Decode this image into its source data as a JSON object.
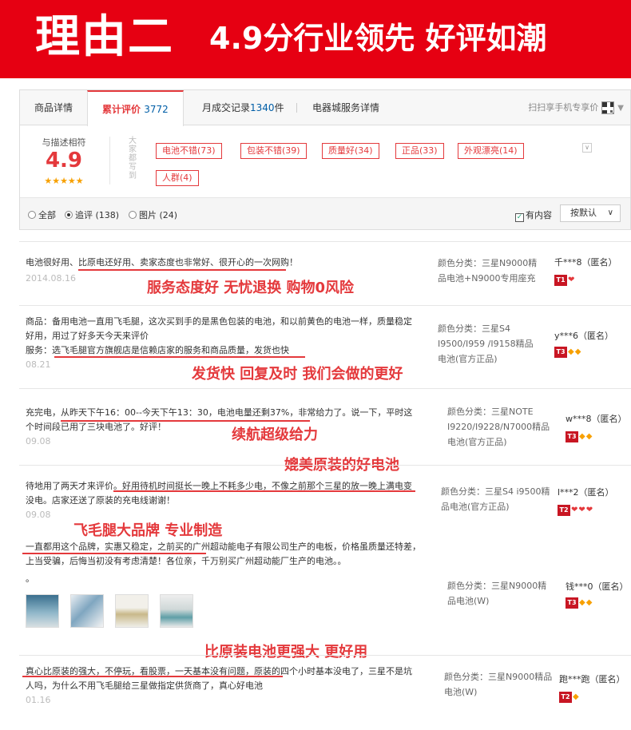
{
  "banner": {
    "reason": "理由二",
    "slogan": "4.9分行业领先 好评如潮"
  },
  "tabs": [
    {
      "label": "商品详情"
    },
    {
      "label": "累计评价",
      "count": "3772"
    },
    {
      "label": "月成交记录",
      "count": "1340",
      "suffix": "件"
    },
    {
      "label": "电器城服务详情"
    }
  ],
  "qr_text": "扫扫享手机专享价",
  "score": {
    "label": "与描述相符",
    "value": "4.9",
    "stars": "★★★★★"
  },
  "tags_caption": "大家都写到",
  "tags": [
    "电池不错(73)",
    "包装不错(39)",
    "质量好(34)",
    "正品(33)",
    "外观漂亮(14)",
    "人群(4)"
  ],
  "filters": {
    "all": "全部",
    "append": "追评 (138)",
    "pics": "图片 (24)",
    "has_content": "有内容",
    "sort": "按默认"
  },
  "reviews": [
    {
      "text": "电池很好用、比原电还好用、卖家态度也非常好、很开心的一次网购！",
      "date": "2014.08.16",
      "sku": "颜色分类：三星N9000精品电池+N9000专用座充",
      "user": "千***8（匿名）",
      "level": "T1"
    },
    {
      "text": "商品：备用电池一直用飞毛腿，这次买到手的是黑色包装的电池，和以前黄色的电池一样，质量稳定好用，用过了好多天今天来评价",
      "text2": "服务：选飞毛腿官方旗舰店是信赖店家的服务和商品质量，发货也快",
      "date": "08.21",
      "sku": "颜色分类：三星S4 I9500/I959 /I9158精品电池(官方正品)",
      "user": "y***6（匿名）",
      "level": "T3"
    },
    {
      "text": "充完电，从昨天下午16：00--今天下午13：30，电池电量还剩37%，非常给力了。说一下，平时这个时间段已用了三块电池了。好评！",
      "date": "09.08",
      "sku": "颜色分类：三星NOTE I9220/I9228/N7000精品电池(官方正品)",
      "user": "w***8（匿名）",
      "level": "T3"
    },
    {
      "text": "待地用了两天才来评价。好用待机时间挺长一晚上不耗多少电，不像之前那个三星的放一晚上满电变没电。店家还送了原装的充电线谢谢！",
      "date": "09.08",
      "sku": "颜色分类：三星S4 i9500精品电池(官方正品)",
      "user": "l***2（匿名）",
      "level": "T2"
    },
    {
      "text": "一直都用这个品牌，实惠又稳定，之前买的广州超动能电子有限公司生产的电板，价格虽质量还特差，上当受骗，后悔当初没有考虑清楚！各位亲，千万别买广州超动能厂生产的电池。。",
      "text2": "。",
      "sku": "颜色分类：三星N9000精品电池(W)",
      "user": "钱***0（匿名）",
      "level": "T3"
    },
    {
      "text": "真心比原装的强大，不停玩，看股票，一天基本没有问题，原装的四个小时基本没电了，三星不是坑人吗，为什么不用飞毛腿给三星做指定供货商了，真心好电池",
      "date": "01.16",
      "sku": "颜色分类：三星N9000精品电池(W)",
      "user": "跑***跑（匿名）",
      "level": "T2"
    }
  ],
  "captions": {
    "c1": "服务态度好 无忧退换 购物0风险",
    "c2": "发货快 回复及时 我们会做的更好",
    "c3": "续航超级给力",
    "c4": "媲美原装的好电池",
    "c5": "飞毛腿大品牌 专业制造",
    "c6": "比原装电池更强大 更好用"
  },
  "colors": {
    "brand_red": "#e60012",
    "accent_red": "#e4393c",
    "link_blue": "#005ea7",
    "star_orange": "#f7a000"
  }
}
